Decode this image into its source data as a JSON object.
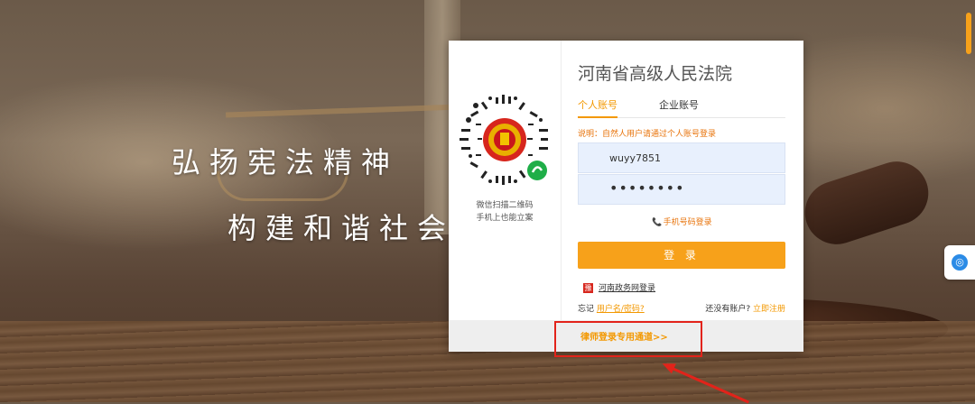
{
  "slogan": {
    "line1": "弘扬宪法精神",
    "line2": "构建和谐社会"
  },
  "qr": {
    "caption_line1": "微信扫描二维码",
    "caption_line2": "手机上也能立案"
  },
  "court_name": "河南省高级人民法院",
  "tabs": {
    "personal": "个人账号",
    "company": "企业账号"
  },
  "note": "说明：自然人用户请通过个人账号登录",
  "form": {
    "username": "wuyy7851",
    "password": "••••••••"
  },
  "phone_login": "手机号码登录",
  "login_button": "登 录",
  "gov_login": "河南政务网登录",
  "forget": {
    "prefix": "忘记",
    "link": "用户名/密码?"
  },
  "register": {
    "prefix": "还没有账户?",
    "link": "立即注册"
  },
  "lawyer_link": "律师登录专用通道>>",
  "colors": {
    "accent": "#f7a11a",
    "annotation": "#e2231a"
  },
  "icons": {
    "phone": "phone-icon",
    "gov": "gov-emblem-icon",
    "side": "assistant-icon"
  }
}
